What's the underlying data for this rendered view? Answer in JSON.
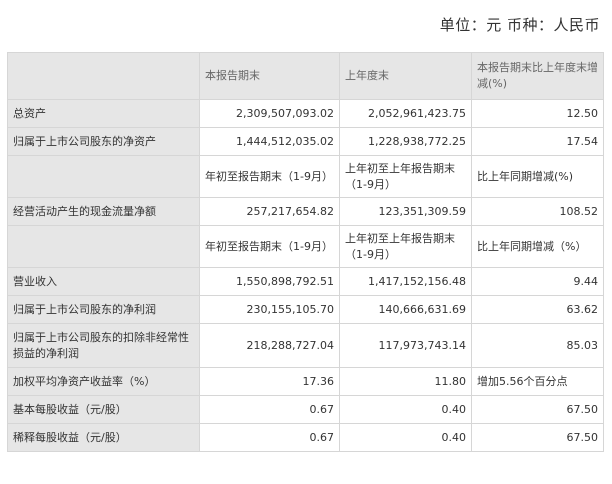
{
  "unit_caption": "单位：元 币种：人民币",
  "header": {
    "col1": "",
    "col2": "本报告期末",
    "col3": "上年度末",
    "col4": "本报告期末比上年度末增减(%)"
  },
  "rows": [
    {
      "label": "总资产",
      "v1": "2,309,507,093.02",
      "v2": "2,052,961,423.75",
      "v3": "12.50"
    },
    {
      "label": "归属于上市公司股东的净资产",
      "v1": "1,444,512,035.02",
      "v2": "1,228,938,772.25",
      "v3": "17.54"
    },
    {
      "label": "",
      "v1": "年初至报告期末（1-9月）",
      "v2": "上年初至上年报告期末（1-9月）",
      "v3": "比上年同期增减(%)"
    },
    {
      "label": "经营活动产生的现金流量净额",
      "v1": "257,217,654.82",
      "v2": "123,351,309.59",
      "v3": "108.52"
    },
    {
      "label": "",
      "v1": "年初至报告期末（1-9月）",
      "v2": "上年初至上年报告期末（1-9月）",
      "v3": "比上年同期增减（%）"
    },
    {
      "label": "营业收入",
      "v1": "1,550,898,792.51",
      "v2": "1,417,152,156.48",
      "v3": "9.44"
    },
    {
      "label": "归属于上市公司股东的净利润",
      "v1": "230,155,105.70",
      "v2": "140,666,631.69",
      "v3": "63.62"
    },
    {
      "label": "归属于上市公司股东的扣除非经常性损益的净利润",
      "v1": "218,288,727.04",
      "v2": "117,973,743.14",
      "v3": "85.03"
    },
    {
      "label": "加权平均净资产收益率（%）",
      "v1": "17.36",
      "v2": "11.80",
      "v3": "增加5.56个百分点"
    },
    {
      "label": "基本每股收益（元/股）",
      "v1": "0.67",
      "v2": "0.40",
      "v3": "67.50"
    },
    {
      "label": "稀释每股收益（元/股）",
      "v1": "0.67",
      "v2": "0.40",
      "v3": "67.50"
    }
  ]
}
